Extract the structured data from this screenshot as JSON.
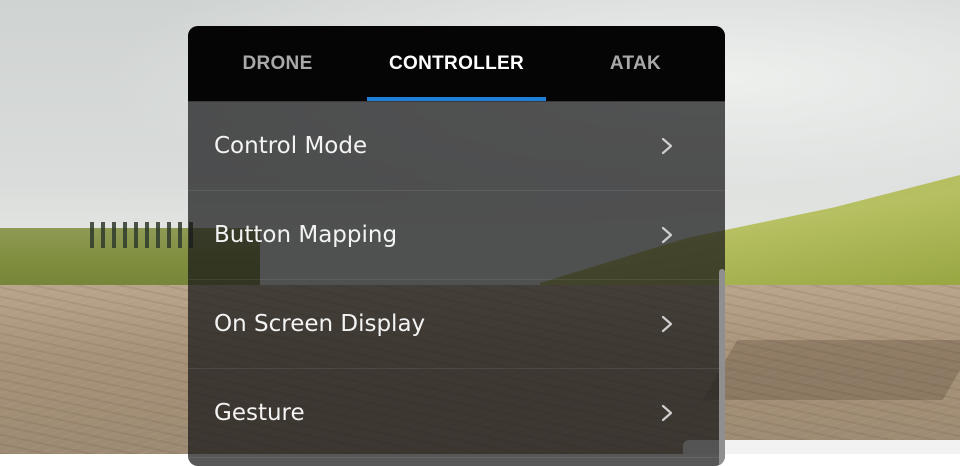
{
  "tabs": [
    {
      "label": "DRONE",
      "active": false
    },
    {
      "label": "CONTROLLER",
      "active": true
    },
    {
      "label": "ATAK",
      "active": false
    }
  ],
  "menu": {
    "items": [
      {
        "label": "Control Mode",
        "icon": "chevron-right-icon"
      },
      {
        "label": "Button Mapping",
        "icon": "chevron-right-icon"
      },
      {
        "label": "On Screen Display",
        "icon": "chevron-right-icon"
      },
      {
        "label": "Gesture",
        "icon": "chevron-right-icon"
      }
    ]
  },
  "colors": {
    "accent": "#1f7fd6",
    "tab_bar": "#050505",
    "active_tab_text": "#ffffff",
    "inactive_tab_text": "#a9a9a9"
  }
}
